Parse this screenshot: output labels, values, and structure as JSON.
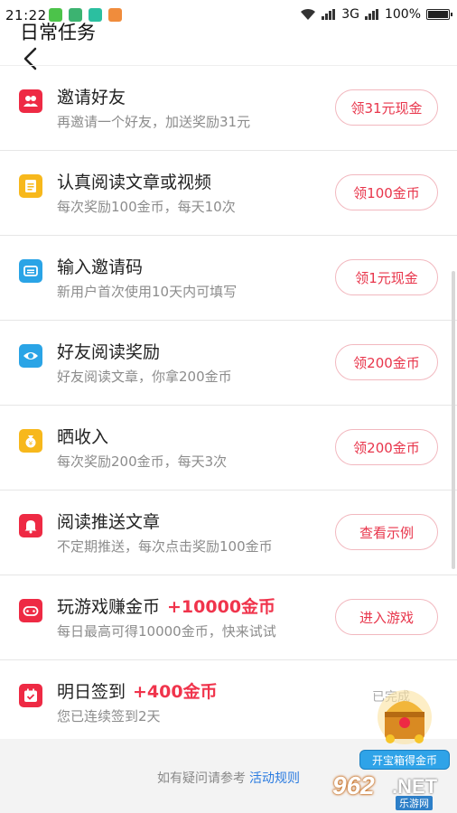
{
  "status_bar": {
    "time": "21:22",
    "network": "3G",
    "battery": "100%"
  },
  "header": {
    "title": "日常任务"
  },
  "tasks": [
    {
      "title": "邀请好友",
      "bonus": "",
      "desc": "再邀请一个好友，加送奖励31元",
      "button": "领31元现金",
      "icon": "users-icon",
      "color": "#ee2a44"
    },
    {
      "title": "认真阅读文章或视频",
      "bonus": "",
      "desc": "每次奖励100金币，每天10次",
      "button": "领100金币",
      "icon": "document-icon",
      "color": "#f7b81c"
    },
    {
      "title": "输入邀请码",
      "bonus": "",
      "desc": "新用户首次使用10天内可填写",
      "button": "领1元现金",
      "icon": "ticket-icon",
      "color": "#2aa4e6"
    },
    {
      "title": "好友阅读奖励",
      "bonus": "",
      "desc": "好友阅读文章，你拿200金币",
      "button": "领200金币",
      "icon": "eye-icon",
      "color": "#2aa4e6"
    },
    {
      "title": "晒收入",
      "bonus": "",
      "desc": "每次奖励200金币，每天3次",
      "button": "领200金币",
      "icon": "money-bag-icon",
      "color": "#f7b81c"
    },
    {
      "title": "阅读推送文章",
      "bonus": "",
      "desc": "不定期推送，每次点击奖励100金币",
      "button": "查看示例",
      "icon": "bell-icon",
      "color": "#ee2a44"
    },
    {
      "title": "玩游戏赚金币",
      "bonus": "+10000金币",
      "desc": "每日最高可得10000金币，快来试试",
      "button": "进入游戏",
      "icon": "gamepad-icon",
      "color": "#ee2a44"
    },
    {
      "title": "明日签到",
      "bonus": "+400金币",
      "desc": "您已连续签到2天",
      "button": "",
      "status": "已完成",
      "icon": "calendar-check-icon",
      "color": "#ee2a44"
    }
  ],
  "footer": {
    "text": "如有疑问请参考",
    "link": "活动规则"
  },
  "promo": {
    "label": "开宝箱得金币"
  },
  "watermark": {
    "brand": "962",
    "suffix": ".NET",
    "sub": "乐游网"
  }
}
